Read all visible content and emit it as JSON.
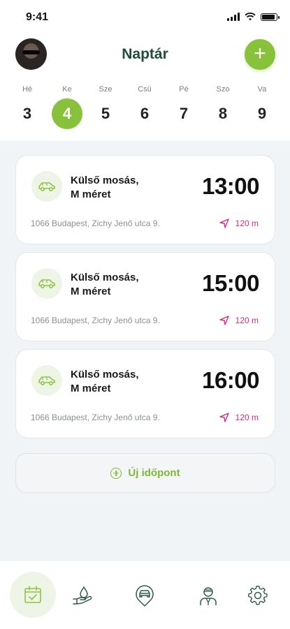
{
  "status": {
    "time": "9:41"
  },
  "header": {
    "title": "Naptár",
    "add_label": "+"
  },
  "days": [
    {
      "name": "Hé",
      "num": "3"
    },
    {
      "name": "Ke",
      "num": "4"
    },
    {
      "name": "Sze",
      "num": "5"
    },
    {
      "name": "Csü",
      "num": "6"
    },
    {
      "name": "Pé",
      "num": "7"
    },
    {
      "name": "Szo",
      "num": "8"
    },
    {
      "name": "Va",
      "num": "9"
    }
  ],
  "selected_day": "4",
  "appointments": [
    {
      "service_line1": "Külső mosás,",
      "service_line2": "M méret",
      "time": "13:00",
      "address": "1066 Budapest, Zichy Jenő utca 9.",
      "distance": "120 m"
    },
    {
      "service_line1": "Külső mosás,",
      "service_line2": "M méret",
      "time": "15:00",
      "address": "1066 Budapest, Zichy Jenő utca 9.",
      "distance": "120 m"
    },
    {
      "service_line1": "Külső mosás,",
      "service_line2": "M méret",
      "time": "16:00",
      "address": "1066 Budapest, Zichy Jenő utca 9.",
      "distance": "120 m"
    }
  ],
  "new_appointment_label": "Új időpont",
  "tabs": [
    {
      "icon": "calendar-check-icon",
      "active": true
    },
    {
      "icon": "water-drop-hand-icon",
      "active": false
    },
    {
      "icon": "car-pin-icon",
      "active": false
    },
    {
      "icon": "user-profile-icon",
      "active": false
    },
    {
      "icon": "gear-icon",
      "active": false
    }
  ],
  "colors": {
    "accent": "#88c13a",
    "title": "#1f4d3a",
    "distance": "#d42a85",
    "icon": "#2f5b48"
  }
}
